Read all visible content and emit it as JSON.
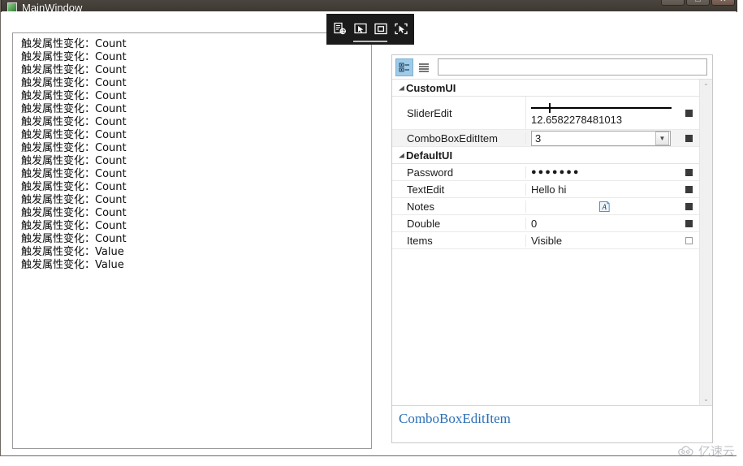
{
  "window": {
    "title": "MainWindow",
    "icon": "app-icon",
    "controls": {
      "minimize": "—",
      "maximize": "□",
      "close": "✕"
    }
  },
  "inspector_toolbar": {
    "buttons": [
      {
        "name": "inspect-element-icon",
        "glyph": "inspect"
      },
      {
        "name": "cursor-frame-icon",
        "glyph": "cursor-frame"
      },
      {
        "name": "frame-select-icon",
        "glyph": "frame"
      },
      {
        "name": "cursor-select-icon",
        "glyph": "cursor-select"
      }
    ]
  },
  "log_panel": {
    "lines": [
      "触发属性变化：Count",
      "触发属性变化：Count",
      "触发属性变化：Count",
      "触发属性变化：Count",
      "触发属性变化：Count",
      "触发属性变化：Count",
      "触发属性变化：Count",
      "触发属性变化：Count",
      "触发属性变化：Count",
      "触发属性变化：Count",
      "触发属性变化：Count",
      "触发属性变化：Count",
      "触发属性变化：Count",
      "触发属性变化：Count",
      "触发属性变化：Count",
      "触发属性变化：Count",
      "触发属性变化：Value",
      "触发属性变化：Value"
    ]
  },
  "property_grid": {
    "toolbar": {
      "categorized_icon": "categorized-view-icon",
      "alphabetical_icon": "alphabetical-view-icon",
      "search_value": "",
      "search_placeholder": ""
    },
    "categories": [
      {
        "name": "CustomUI",
        "expanded": true,
        "rows": [
          {
            "label": "SliderEdit",
            "editor": "slider",
            "value": "12.6582278481013",
            "slider_percent": 13,
            "marker": "filled"
          },
          {
            "label": "ComboBoxEditItem",
            "editor": "combobox",
            "value": "3",
            "marker": "filled"
          }
        ]
      },
      {
        "name": "DefaultUI",
        "expanded": true,
        "rows": [
          {
            "label": "Password",
            "editor": "password",
            "value": "●●●●●●●",
            "marker": "filled"
          },
          {
            "label": "TextEdit",
            "editor": "text",
            "value": "Hello hi",
            "marker": "filled"
          },
          {
            "label": "Notes",
            "editor": "document-icon",
            "value": "A",
            "marker": "filled"
          },
          {
            "label": "Double",
            "editor": "text",
            "value": "0",
            "marker": "filled"
          },
          {
            "label": "Items",
            "editor": "text",
            "value": "Visible",
            "marker": "empty"
          }
        ]
      }
    ],
    "scrollbar": {
      "up_arrow": "⌃",
      "down_arrow": "⌄"
    },
    "description": {
      "title": "ComboBoxEditItem"
    }
  },
  "watermark": {
    "text": "亿速云",
    "icon": "cloud-logo-icon"
  }
}
